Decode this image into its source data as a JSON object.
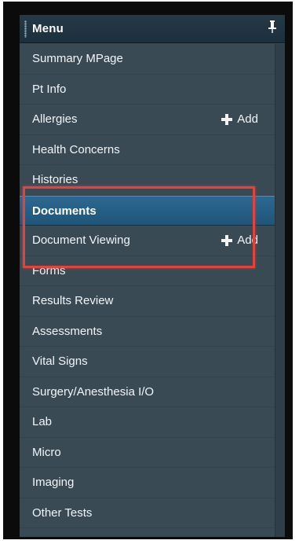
{
  "menu": {
    "title": "Menu",
    "items": [
      {
        "label": "Summary MPage"
      },
      {
        "label": "Pt Info"
      },
      {
        "label": "Allergies",
        "action": "Add"
      },
      {
        "label": "Health Concerns"
      },
      {
        "label": "Histories"
      },
      {
        "label": "Documents",
        "active": true
      },
      {
        "label": "Document Viewing",
        "action": "Add"
      },
      {
        "label": "Forms"
      },
      {
        "label": "Results Review"
      },
      {
        "label": "Assessments"
      },
      {
        "label": "Vital Signs"
      },
      {
        "label": "Surgery/Anesthesia I/O"
      },
      {
        "label": "Lab"
      },
      {
        "label": "Micro"
      },
      {
        "label": "Imaging"
      },
      {
        "label": "Other Tests"
      }
    ]
  },
  "icons": {
    "pin": "pin-icon",
    "add": "plus-icon"
  },
  "colors": {
    "panel_bg": "#3a4a55",
    "header_bg": "#1c2f3c",
    "active_bg": "#1f5578",
    "highlight": "#e0443c"
  }
}
